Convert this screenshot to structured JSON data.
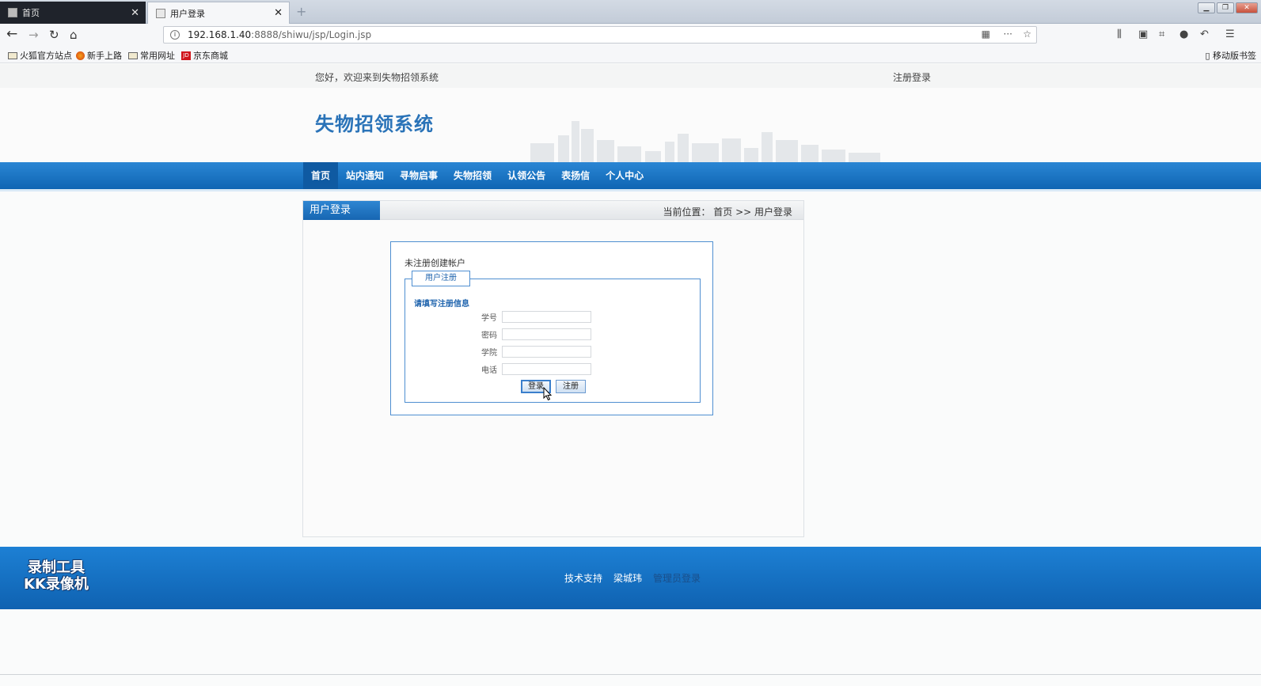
{
  "browser": {
    "tabs": [
      {
        "title": "首页",
        "active": false
      },
      {
        "title": "用户登录",
        "active": true
      }
    ],
    "new_tab_glyph": "+",
    "url_host": "192.168.1.40",
    "url_path": ":8888/shiwu/jsp/Login.jsp",
    "bookmarks": [
      {
        "label": "火狐官方站点",
        "icon": "folder-icon"
      },
      {
        "label": "新手上路",
        "icon": "firefox-icon"
      },
      {
        "label": "常用网址",
        "icon": "folder-icon"
      },
      {
        "label": "京东商城",
        "icon": "jd-icon",
        "icon_text": "JD"
      }
    ],
    "mobile_bookmarks": "移动版书签"
  },
  "header": {
    "welcome": "您好，欢迎来到失物招领系统",
    "register_login": "注册登录",
    "site_title": "失物招领系统"
  },
  "nav": {
    "items": [
      "首页",
      "站内通知",
      "寻物启事",
      "失物招领",
      "认领公告",
      "表扬信",
      "个人中心"
    ],
    "active_index": 0
  },
  "content": {
    "title": "用户登录",
    "breadcrumb": "当前位置： 首页 >> 用户登录",
    "hint": "未注册创建帐户",
    "legend": "用户注册",
    "form_title": "请填写注册信息",
    "fields": [
      {
        "label": "学号",
        "value": ""
      },
      {
        "label": "密码",
        "value": ""
      },
      {
        "label": "学院",
        "value": ""
      },
      {
        "label": "电话",
        "value": ""
      }
    ],
    "login_button": "登录",
    "register_button": "注册"
  },
  "footer": {
    "links": [
      "技术支持",
      "梁城玮"
    ],
    "dim_link": "管理员登录",
    "watermark_line1": "录制工具",
    "watermark_line2": "KK录像机"
  },
  "colors": {
    "accent_blue": "#1766b2",
    "title_blue": "#2a73b8",
    "form_border": "#4f8fd1"
  }
}
